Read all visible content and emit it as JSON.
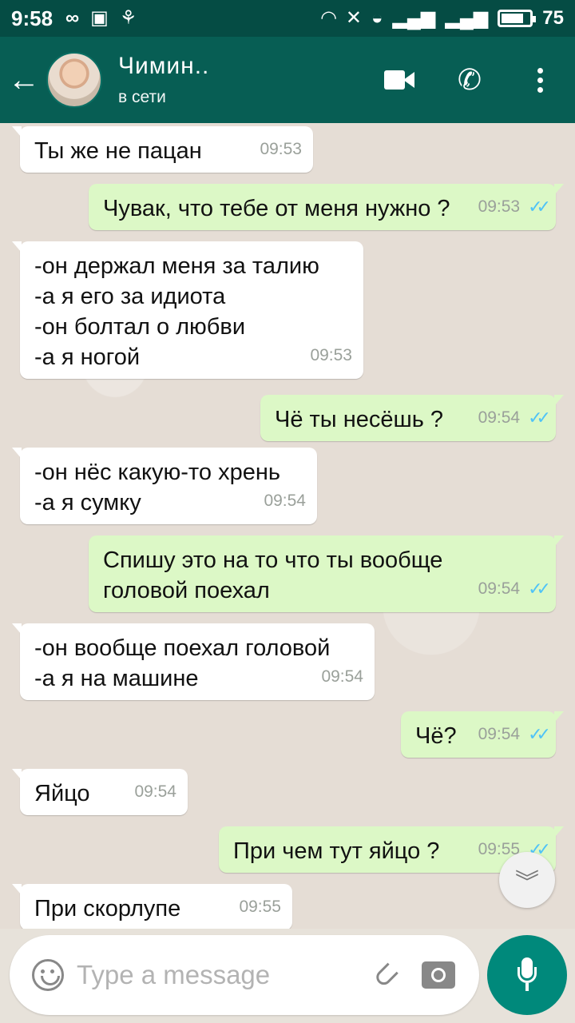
{
  "status_bar": {
    "time": "9:58",
    "battery": "75",
    "battery_level": 0.75,
    "left_icons": [
      "infinity-icon",
      "image-icon",
      "link-icon"
    ],
    "right_icons": [
      "headset-icon",
      "mute-icon",
      "wifi-icon",
      "signal-icon",
      "4g-signal-icon",
      "battery-icon"
    ]
  },
  "header": {
    "contact_name": "Чимин..",
    "contact_status": "в сети"
  },
  "messages": [
    {
      "dir": "in",
      "text": "Ты же не пацан",
      "time": "09:53"
    },
    {
      "dir": "out",
      "text": "Чувак, что тебе от меня нужно ?",
      "time": "09:53"
    },
    {
      "dir": "in",
      "text": "-он держал меня за талию\n-а я его за идиота\n-он болтал о любви\n-а я ногой",
      "time": "09:53"
    },
    {
      "dir": "out",
      "text": "Чё ты несёшь ?",
      "time": "09:54"
    },
    {
      "dir": "in",
      "text": "-он нёс какую-то хрень\n-а я сумку",
      "time": "09:54"
    },
    {
      "dir": "out",
      "text": "Спишу это на то что ты вообще\nголовой поехал",
      "time": "09:54"
    },
    {
      "dir": "in",
      "text": "-он вообще поехал головой\n-а я на машине",
      "time": "09:54"
    },
    {
      "dir": "out",
      "text": "Чё?",
      "time": "09:54"
    },
    {
      "dir": "in",
      "text": "Яйцо",
      "time": "09:54"
    },
    {
      "dir": "out",
      "text": "При чем тут яйцо ?",
      "time": "09:55"
    },
    {
      "dir": "in",
      "text": "При скорлупе",
      "time": "09:55"
    }
  ],
  "input": {
    "placeholder": "Type a message"
  },
  "colors": {
    "header": "#075e54",
    "status_bar": "#054c44",
    "outgoing_bubble": "#dcf8c6",
    "incoming_bubble": "#ffffff",
    "read_ticks": "#4fc3f7",
    "mic_button": "#00897b"
  }
}
